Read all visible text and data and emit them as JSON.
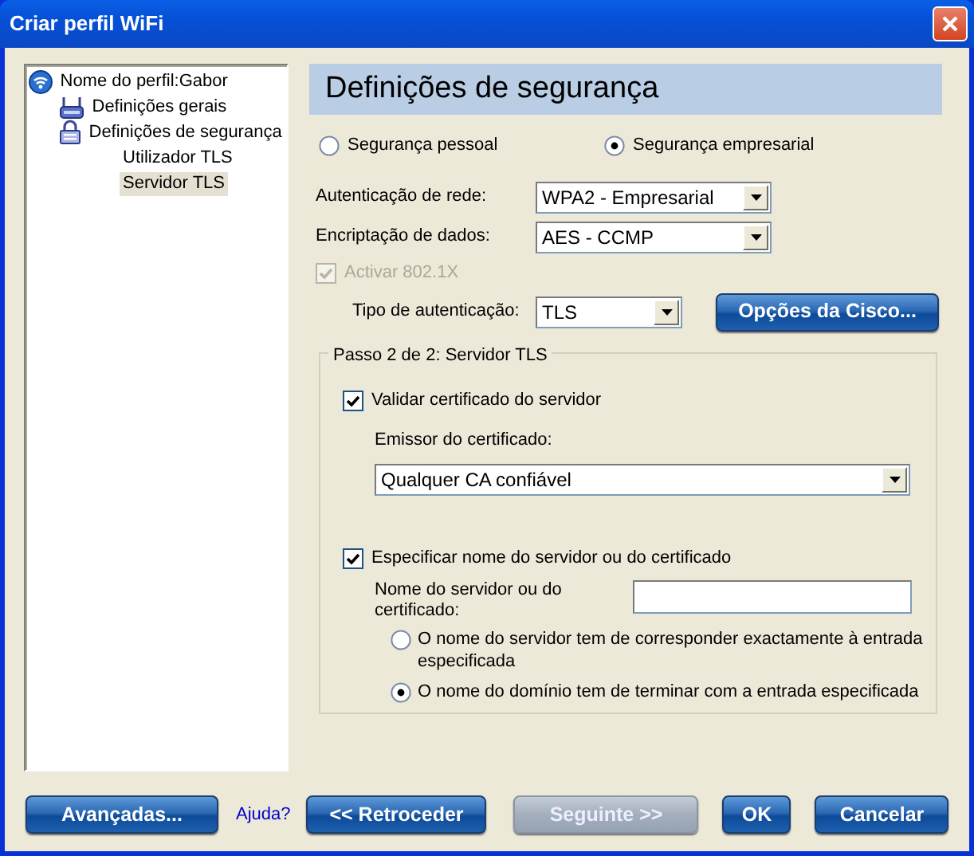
{
  "window": {
    "title": "Criar perfil WiFi"
  },
  "tree": [
    {
      "label": "Nome do perfil:Gabor",
      "kind": "wifi",
      "selected": false,
      "children": [
        {
          "label": "Definições gerais",
          "kind": "router",
          "selected": false
        },
        {
          "label": "Definições de segurança",
          "kind": "lock",
          "selected": false,
          "children": [
            {
              "label": "Utilizador TLS",
              "selected": false
            },
            {
              "label": "Servidor TLS",
              "selected": true
            }
          ]
        }
      ]
    }
  ],
  "panel_title": "Definições de segurança",
  "security_modes": [
    {
      "label": "Segurança pessoal",
      "selected": false
    },
    {
      "label": "Segurança empresarial",
      "selected": true
    }
  ],
  "fields": [
    {
      "label": "Autenticação de rede:",
      "value": "WPA2 - Empresarial"
    },
    {
      "label": "Encriptação de dados:",
      "value": "AES - CCMP"
    }
  ],
  "enable_8021x": {
    "label": "Activar 802.1X",
    "checked": true,
    "disabled": true
  },
  "auth_type": {
    "label": "Tipo de autenticação:",
    "value": "TLS"
  },
  "cisco_button": "Opções da Cisco...",
  "step_group": {
    "title": "Passo 2 de 2: Servidor TLS",
    "validate": {
      "label": "Validar certificado do servidor",
      "checked": true
    },
    "issuer": {
      "label": "Emissor do certificado:",
      "value": "Qualquer CA confiável"
    },
    "specify": {
      "label": "Especificar nome do servidor ou do certificado",
      "checked": true
    },
    "server_name": {
      "label": "Nome do servidor ou do certificado:"
    },
    "match_options": [
      {
        "label": "O nome do servidor tem de corresponder exactamente à entrada especificada",
        "selected": false
      },
      {
        "label": "O nome do domínio tem de terminar com a entrada especificada",
        "selected": true
      }
    ]
  },
  "buttons": [
    {
      "label": "Avançadas...",
      "disabled": false
    },
    {
      "label": "<< Retroceder",
      "disabled": false
    },
    {
      "label": "Seguinte >>",
      "disabled": true
    },
    {
      "label": "OK",
      "disabled": false
    },
    {
      "label": "Cancelar",
      "disabled": false
    }
  ],
  "help_link": "Ajuda?"
}
